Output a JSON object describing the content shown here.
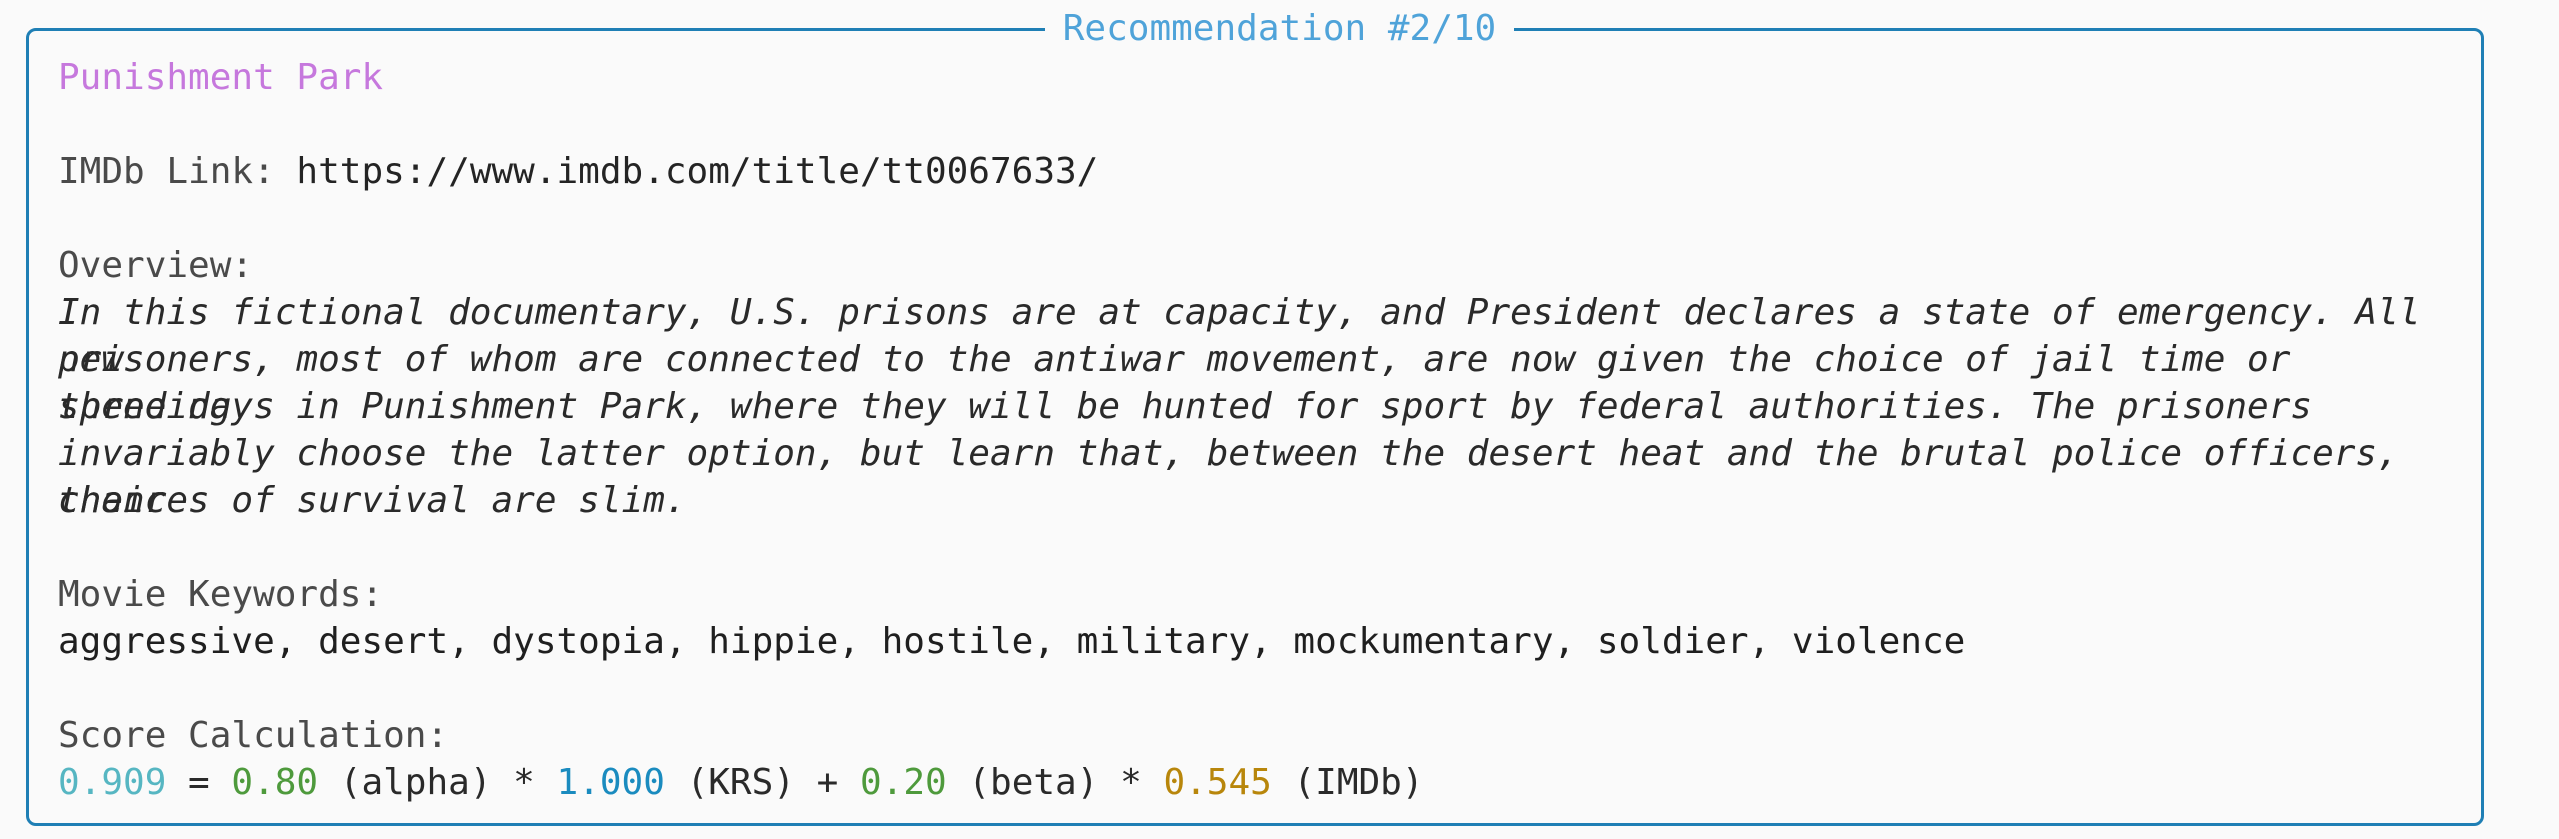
{
  "panel": {
    "title": "Recommendation #2/10",
    "border_color": "#1f7fb5",
    "title_color": "#4fa3d9"
  },
  "movie": {
    "title": "Punishment Park",
    "title_color": "#c678dd",
    "imdb_label": "IMDb Link: ",
    "imdb_url": "https://www.imdb.com/title/tt0067633/",
    "overview_label": "Overview:",
    "overview_lines": [
      "In this fictional documentary, U.S. prisons are at capacity, and President declares a state of emergency. All new",
      "prisoners, most of whom are connected to the antiwar movement, are now given the choice of jail time or spending",
      "three days in Punishment Park, where they will be hunted for sport by federal authorities. The prisoners",
      "invariably choose the latter option, but learn that, between the desert heat and the brutal police officers, their",
      "chances of survival are slim."
    ],
    "keywords_label": "Movie Keywords:",
    "keywords": "aggressive, desert, dystopia, hippie, hostile, military, mockumentary, soldier, violence"
  },
  "score": {
    "label": "Score Calculation:",
    "total": "0.909",
    "eq": " = ",
    "alpha": "0.80",
    "alpha_label": " (alpha) * ",
    "krs": "1.000",
    "krs_label": " (KRS) + ",
    "beta": "0.20",
    "beta_label": " (beta) * ",
    "imdb": "0.545",
    "imdb_label": " (IMDb)"
  }
}
